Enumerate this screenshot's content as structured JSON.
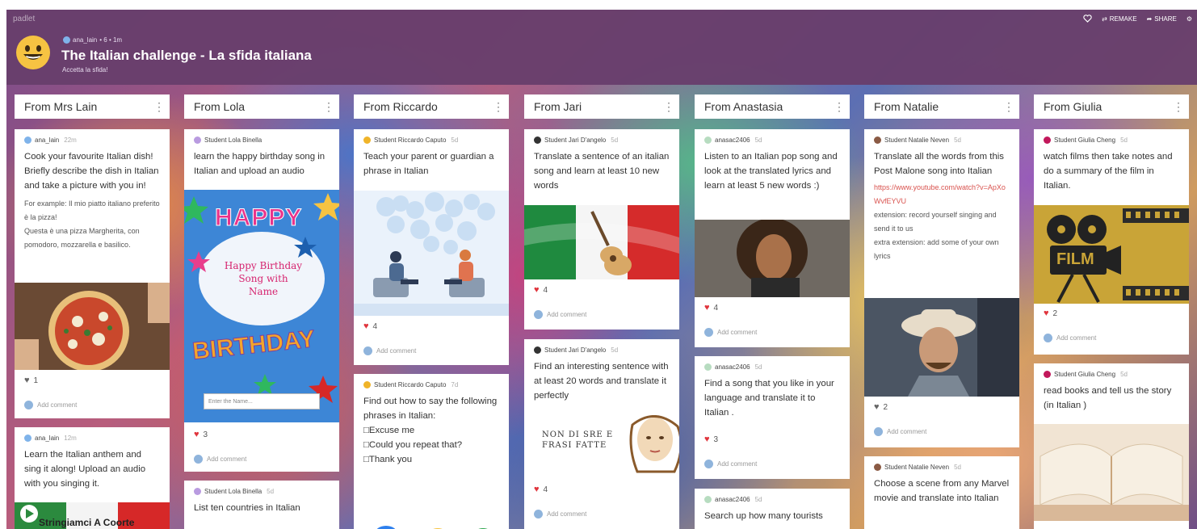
{
  "header": {
    "brand": "padlet",
    "author": "ana_lain",
    "meta": "• 6 • 1m",
    "title": "The Italian challenge - La sfida italiana",
    "subtitle": "Accetta la sfida!",
    "actions": [
      "REMAKE",
      "SHARE"
    ]
  },
  "columns": [
    {
      "title": "From Mrs Lain"
    },
    {
      "title": "From Lola"
    },
    {
      "title": "From Riccardo"
    },
    {
      "title": "From Jari"
    },
    {
      "title": "From Anastasia"
    },
    {
      "title": "From Natalie"
    },
    {
      "title": "From Giulia"
    }
  ],
  "cards": {
    "lain1": {
      "author": "ana_lain",
      "time": "22m",
      "body": "Cook your favourite Italian dish! Briefly describe the dish in Italian and take a picture with you in!",
      "extra": [
        "For example: Il mio piatto italiano preferito è la pizza!",
        "Questa è una pizza Margherita, con pomodoro, mozzarella e basilico."
      ],
      "likes": "1"
    },
    "lain2": {
      "author": "ana_lain",
      "time": "12m",
      "body": "Learn the Italian anthem and sing it along! Upload an audio with you singing it.",
      "media_title": "Stringiamci A Coorte"
    },
    "lola1": {
      "author": "Student Lola Binella",
      "time": "5d",
      "body": "learn the happy birthday song in Italian and upload an audio",
      "img_top": "HAPPY",
      "img_mid": "Happy Birthday Song with Name",
      "img_bottom": "BIRTHDAY",
      "img_input": "Enter the Name...",
      "likes": "3"
    },
    "lola2": {
      "author": "Student Lola Binella",
      "time": "5d",
      "body": "List ten countries in Italian"
    },
    "ricc1": {
      "author": "Student Riccardo Caputo",
      "time": "5d",
      "body": "Teach your parent or guardian a phrase in Italian",
      "likes": "4"
    },
    "ricc2": {
      "author": "Student Riccardo Caputo",
      "time": "7d",
      "body": "Find out how to say the following phrases in Italian:",
      "lines": [
        "□Excuse me",
        "□Could you repeat that?",
        "□Thank you"
      ]
    },
    "jari1": {
      "author": "Student Jari D'angelo",
      "time": "5d",
      "body": "Translate a sentence of an italian song and learn at least 10 new words",
      "likes": "4"
    },
    "jari2": {
      "author": "Student Jari D'angelo",
      "time": "5d",
      "body": "Find an interesting sentence with at least 20 words and translate it perfectly",
      "img_text": "NON DI SRE E FRASI FATTE",
      "likes": "4"
    },
    "ana1": {
      "author": "anasac2406",
      "time": "5d",
      "body": "Listen to an Italian pop song and look at the translated lyrics and learn at least 5 new words :)",
      "likes": "4"
    },
    "ana2": {
      "author": "anasac2406",
      "time": "5d",
      "body": "Find a song that you like in your language and translate it to Italian .",
      "likes": "3"
    },
    "ana3": {
      "author": "anasac2406",
      "time": "5d",
      "body": "Search up how many tourists"
    },
    "nat1": {
      "author": "Student Natalie Neven",
      "time": "5d",
      "body": "Translate all the words from this Post Malone song into Italian",
      "link": "https://www.youtube.com/watch?v=ApXoWvfEYVU",
      "extra": [
        "extension: record yourself singing and send it to us",
        "extra extension: add some of your own lyrics"
      ],
      "likes": "2"
    },
    "nat2": {
      "author": "Student Natalie Neven",
      "time": "5d",
      "body": "Choose a scene from any Marvel movie and translate into Italian"
    },
    "giu1": {
      "author": "Student Giulia Cheng",
      "time": "5d",
      "body": "watch films then take notes and do a summary of the film in Italian.",
      "img_text": "FILM",
      "likes": "2"
    },
    "giu2": {
      "author": "Student Giulia Cheng",
      "time": "5d",
      "body": "read books and tell us the story (in Italian )"
    }
  },
  "add_comment": "Add comment",
  "colors": {
    "topbar": "#683e6c",
    "heart": "#e0343c",
    "link": "#d9534f"
  }
}
